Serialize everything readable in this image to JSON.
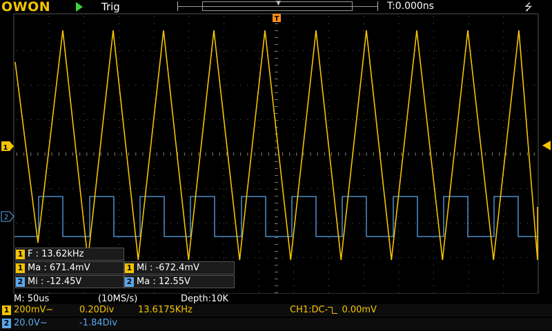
{
  "header": {
    "logo": "OWON",
    "trigger_status": "Trig",
    "time_offset": "T:0.000ns",
    "usb_icon": "usb-icon"
  },
  "markers": {
    "trigger_marker": "T",
    "ch1_marker": "1",
    "ch2_marker": "2"
  },
  "measurements": {
    "freq": {
      "ch": "1",
      "text": "F : 13.62kHz"
    },
    "ch1_max": {
      "ch": "1",
      "text": "Ma : 671.4mV"
    },
    "ch1_min": {
      "ch": "1",
      "text": "Mi : -672.4mV"
    },
    "ch2_min": {
      "ch": "2",
      "text": "Mi : -12.45V"
    },
    "ch2_max": {
      "ch": "2",
      "text": "Ma : 12.55V"
    }
  },
  "status": {
    "timebase": "M: 50us",
    "sample_rate": "(10MS/s)",
    "depth": "Depth:10K",
    "ch1_badge": "1",
    "ch1_scale": "200mV~",
    "ch1_pos": "0.20Div",
    "ch1_freq": "13.6175KHz",
    "trigger_info_prefix": "CH1:DC-",
    "trigger_info_level": "0.00mV",
    "ch2_badge": "2",
    "ch2_scale": "20.0V~",
    "ch2_pos": "-1.84Div"
  },
  "colors": {
    "ch1": "#f5c400",
    "ch2": "#5ba7ec",
    "run": "#3ad43a"
  }
}
